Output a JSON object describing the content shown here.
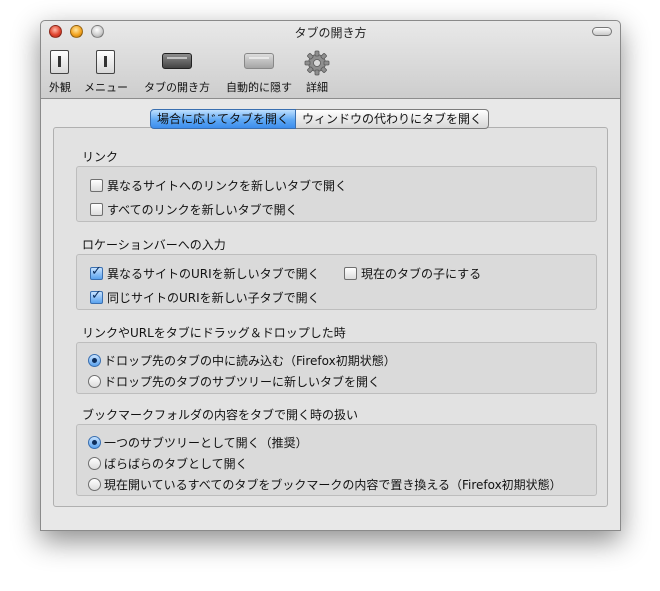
{
  "window": {
    "title": "タブの開き方"
  },
  "toolbar": {
    "items": [
      {
        "label": "外観",
        "icon": "switch-icon"
      },
      {
        "label": "メニュー",
        "icon": "switch-icon"
      },
      {
        "label": "タブの開き方",
        "icon": "tab-tray-icon"
      },
      {
        "label": "自動的に隠す",
        "icon": "tab-tray-icon"
      },
      {
        "label": "詳細",
        "icon": "gear-icon"
      }
    ]
  },
  "tabs": [
    {
      "label": "場合に応じてタブを開く",
      "selected": true
    },
    {
      "label": "ウィンドウの代わりにタブを開く",
      "selected": false
    }
  ],
  "sections": {
    "link": {
      "title": "リンク",
      "items": [
        {
          "label": "異なるサイトへのリンクを新しいタブで開く",
          "checked": false
        },
        {
          "label": "すべてのリンクを新しいタブで開く",
          "checked": false
        }
      ]
    },
    "location": {
      "title": "ロケーションバーへの入力",
      "items": [
        {
          "label": "異なるサイトのURIを新しいタブで開く",
          "checked": true
        },
        {
          "label": "現在のタブの子にする",
          "checked": false
        },
        {
          "label": "同じサイトのURIを新しい子タブで開く",
          "checked": true
        }
      ]
    },
    "drag": {
      "title": "リンクやURLをタブにドラッグ＆ドロップした時",
      "items": [
        {
          "label": "ドロップ先のタブの中に読み込む（Firefox初期状態）",
          "selected": true
        },
        {
          "label": "ドロップ先のタブのサブツリーに新しいタブを開く",
          "selected": false
        }
      ]
    },
    "bookmark": {
      "title": "ブックマークフォルダの内容をタブで開く時の扱い",
      "items": [
        {
          "label": "一つのサブツリーとして開く（推奨）",
          "selected": true
        },
        {
          "label": "ばらばらのタブとして開く",
          "selected": false
        },
        {
          "label": "現在開いているすべてのタブをブックマークの内容で置き換える（Firefox初期状態）",
          "selected": false
        }
      ]
    }
  }
}
